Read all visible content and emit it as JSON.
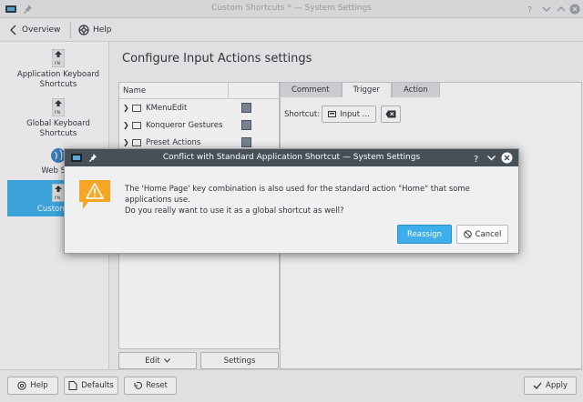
{
  "window": {
    "title": "Custom Shortcuts * — System Settings",
    "toolbar": {
      "overview_label": "Overview",
      "help_label": "Help"
    }
  },
  "sidebar": {
    "items": [
      {
        "label": "Application Keyboard Shortcuts"
      },
      {
        "label": "Global Keyboard Shortcuts"
      },
      {
        "label": "Web Sho"
      },
      {
        "label": "Custom Sh"
      }
    ],
    "fn_text": "FN"
  },
  "main": {
    "heading": "Configure Input Actions settings",
    "tree": {
      "column_name": "Name",
      "rows": [
        {
          "label": "KMenuEdit"
        },
        {
          "label": "Konqueror Gestures"
        },
        {
          "label": "Preset Actions"
        }
      ]
    },
    "tabs": [
      {
        "label": "Comment"
      },
      {
        "label": "Trigger"
      },
      {
        "label": "Action"
      }
    ],
    "shortcut_label": "Shortcut:",
    "input_button_label": "Input ...",
    "edit_label": "Edit",
    "settings_label": "Settings"
  },
  "bottom": {
    "help_label": "Help",
    "defaults_label": "Defaults",
    "reset_label": "Reset",
    "apply_label": "Apply"
  },
  "dialog": {
    "title": "Conflict with Standard Application Shortcut — System Settings",
    "message_line1": "The 'Home Page' key combination is also used for the standard action \"Home\" that some applications use.",
    "message_line2": "Do you really want to use it as a global shortcut as well?",
    "reassign_label": "Reassign",
    "cancel_label": "Cancel"
  },
  "colors": {
    "accent": "#3daee9",
    "dialog_title": "#475057",
    "warning": "#f6a623"
  }
}
